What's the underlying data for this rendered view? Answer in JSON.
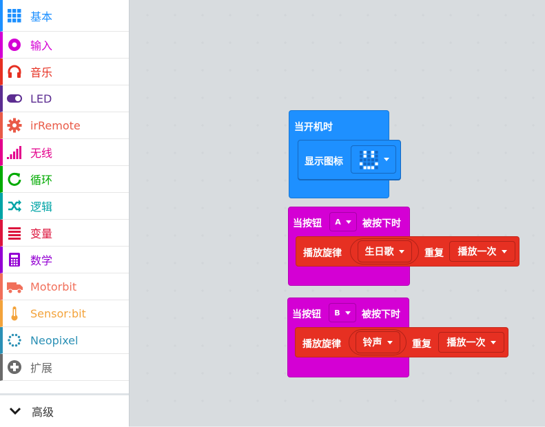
{
  "toolbox": {
    "categories": [
      {
        "label": "基本",
        "color": "#1e90ff",
        "icon": "grid-icon"
      },
      {
        "label": "输入",
        "color": "#d400d4",
        "icon": "record-icon"
      },
      {
        "label": "音乐",
        "color": "#e63022",
        "icon": "headphones-icon"
      },
      {
        "label": "LED",
        "color": "#5c2d91",
        "icon": "toggle-icon"
      },
      {
        "label": "irRemote",
        "color": "#e95a47",
        "icon": "gear-icon"
      },
      {
        "label": "无线",
        "color": "#e3008c",
        "icon": "signal-icon"
      },
      {
        "label": "循环",
        "color": "#00aa00",
        "icon": "refresh-icon"
      },
      {
        "label": "逻辑",
        "color": "#00a4a6",
        "icon": "shuffle-icon"
      },
      {
        "label": "变量",
        "color": "#dc143c",
        "icon": "list-icon"
      },
      {
        "label": "数学",
        "color": "#9400d3",
        "icon": "calculator-icon"
      },
      {
        "label": "Motorbit",
        "color": "#f16f5a",
        "icon": "truck-icon"
      },
      {
        "label": "Sensor:bit",
        "color": "#f3a33b",
        "icon": "thermometer-icon"
      },
      {
        "label": "Neopixel",
        "color": "#2b90b5",
        "icon": "ring-icon"
      },
      {
        "label": "扩展",
        "color": "#6a6a6a",
        "icon": "plus-circle-icon"
      }
    ],
    "advanced": {
      "label": "高级",
      "icon": "chevron-down-icon"
    }
  },
  "blocks": {
    "on_start": {
      "label": "当开机时",
      "color": "#1e90ff",
      "show_icon_label": "显示图标"
    },
    "button_a": {
      "prefix": "当按钮",
      "button": "A",
      "suffix": "被按下时",
      "color": "#d400d4",
      "play": {
        "label": "播放旋律",
        "melody": "生日歌",
        "repeat_label": "重复",
        "repeat": "播放一次",
        "color": "#e63022"
      }
    },
    "button_b": {
      "prefix": "当按钮",
      "button": "B",
      "suffix": "被按下时",
      "color": "#d400d4",
      "play": {
        "label": "播放旋律",
        "melody": "铃声",
        "repeat_label": "重复",
        "repeat": "播放一次",
        "color": "#e63022"
      }
    }
  }
}
